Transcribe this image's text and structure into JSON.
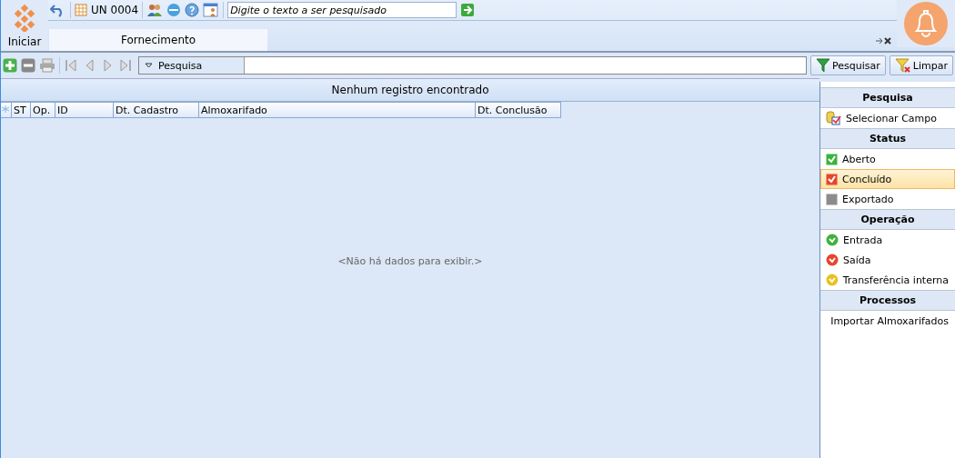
{
  "start_button": {
    "label": "Iniciar"
  },
  "toolbar": {
    "unit": "UN 0004",
    "search": {
      "placeholder": "Digite o texto a ser pesquisado"
    }
  },
  "tabs": [
    {
      "label": "Fornecimento",
      "selected": true
    }
  ],
  "filter_bar": {
    "dropdown": "Pesquisa",
    "buttons": [
      {
        "label": "Pesquisar",
        "kind": "filter"
      },
      {
        "label": "Limpar",
        "kind": "clear"
      }
    ]
  },
  "grid": {
    "group_panel": "Nenhum registro encontrado",
    "columns": [
      "ST",
      "Op.",
      "ID",
      "Dt. Cadastro",
      "Almoxarifado",
      "Dt. Conclusão"
    ],
    "empty_text": "<Não há dados para exibir.>"
  },
  "sidebar": {
    "sections": [
      {
        "title": "Pesquisa",
        "items": [
          {
            "label": "Selecionar Campo",
            "kind": "field",
            "selected": false
          }
        ]
      },
      {
        "title": "Status",
        "items": [
          {
            "label": "Aberto",
            "kind": "square",
            "color": "#3cb33c",
            "selected": false
          },
          {
            "label": "Concluído",
            "kind": "square",
            "color": "#e8452c",
            "selected": true
          },
          {
            "label": "Exportado",
            "kind": "square",
            "color": "#8c8c8c",
            "selected": false
          }
        ]
      },
      {
        "title": "Operação",
        "items": [
          {
            "label": "Entrada",
            "kind": "circle",
            "color": "#3cb33c",
            "selected": false
          },
          {
            "label": "Saída",
            "kind": "circle",
            "color": "#e8452c",
            "selected": false
          },
          {
            "label": "Transferência interna",
            "kind": "circle",
            "color": "#e8c21c",
            "selected": false
          }
        ]
      },
      {
        "title": "Processos",
        "items": [
          {
            "label": "Importar Almoxarifados",
            "kind": "import",
            "selected": false
          }
        ]
      }
    ]
  }
}
